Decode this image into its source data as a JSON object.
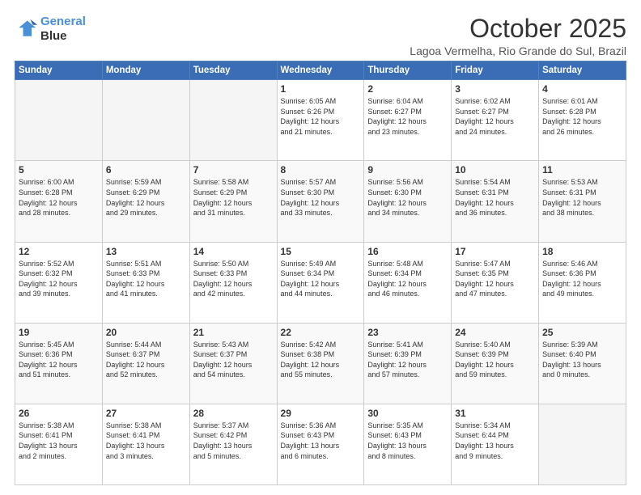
{
  "logo": {
    "line1": "General",
    "line2": "Blue"
  },
  "header": {
    "month": "October 2025",
    "location": "Lagoa Vermelha, Rio Grande do Sul, Brazil"
  },
  "weekdays": [
    "Sunday",
    "Monday",
    "Tuesday",
    "Wednesday",
    "Thursday",
    "Friday",
    "Saturday"
  ],
  "weeks": [
    [
      {
        "day": "",
        "info": ""
      },
      {
        "day": "",
        "info": ""
      },
      {
        "day": "",
        "info": ""
      },
      {
        "day": "1",
        "info": "Sunrise: 6:05 AM\nSunset: 6:26 PM\nDaylight: 12 hours\nand 21 minutes."
      },
      {
        "day": "2",
        "info": "Sunrise: 6:04 AM\nSunset: 6:27 PM\nDaylight: 12 hours\nand 23 minutes."
      },
      {
        "day": "3",
        "info": "Sunrise: 6:02 AM\nSunset: 6:27 PM\nDaylight: 12 hours\nand 24 minutes."
      },
      {
        "day": "4",
        "info": "Sunrise: 6:01 AM\nSunset: 6:28 PM\nDaylight: 12 hours\nand 26 minutes."
      }
    ],
    [
      {
        "day": "5",
        "info": "Sunrise: 6:00 AM\nSunset: 6:28 PM\nDaylight: 12 hours\nand 28 minutes."
      },
      {
        "day": "6",
        "info": "Sunrise: 5:59 AM\nSunset: 6:29 PM\nDaylight: 12 hours\nand 29 minutes."
      },
      {
        "day": "7",
        "info": "Sunrise: 5:58 AM\nSunset: 6:29 PM\nDaylight: 12 hours\nand 31 minutes."
      },
      {
        "day": "8",
        "info": "Sunrise: 5:57 AM\nSunset: 6:30 PM\nDaylight: 12 hours\nand 33 minutes."
      },
      {
        "day": "9",
        "info": "Sunrise: 5:56 AM\nSunset: 6:30 PM\nDaylight: 12 hours\nand 34 minutes."
      },
      {
        "day": "10",
        "info": "Sunrise: 5:54 AM\nSunset: 6:31 PM\nDaylight: 12 hours\nand 36 minutes."
      },
      {
        "day": "11",
        "info": "Sunrise: 5:53 AM\nSunset: 6:31 PM\nDaylight: 12 hours\nand 38 minutes."
      }
    ],
    [
      {
        "day": "12",
        "info": "Sunrise: 5:52 AM\nSunset: 6:32 PM\nDaylight: 12 hours\nand 39 minutes."
      },
      {
        "day": "13",
        "info": "Sunrise: 5:51 AM\nSunset: 6:33 PM\nDaylight: 12 hours\nand 41 minutes."
      },
      {
        "day": "14",
        "info": "Sunrise: 5:50 AM\nSunset: 6:33 PM\nDaylight: 12 hours\nand 42 minutes."
      },
      {
        "day": "15",
        "info": "Sunrise: 5:49 AM\nSunset: 6:34 PM\nDaylight: 12 hours\nand 44 minutes."
      },
      {
        "day": "16",
        "info": "Sunrise: 5:48 AM\nSunset: 6:34 PM\nDaylight: 12 hours\nand 46 minutes."
      },
      {
        "day": "17",
        "info": "Sunrise: 5:47 AM\nSunset: 6:35 PM\nDaylight: 12 hours\nand 47 minutes."
      },
      {
        "day": "18",
        "info": "Sunrise: 5:46 AM\nSunset: 6:36 PM\nDaylight: 12 hours\nand 49 minutes."
      }
    ],
    [
      {
        "day": "19",
        "info": "Sunrise: 5:45 AM\nSunset: 6:36 PM\nDaylight: 12 hours\nand 51 minutes."
      },
      {
        "day": "20",
        "info": "Sunrise: 5:44 AM\nSunset: 6:37 PM\nDaylight: 12 hours\nand 52 minutes."
      },
      {
        "day": "21",
        "info": "Sunrise: 5:43 AM\nSunset: 6:37 PM\nDaylight: 12 hours\nand 54 minutes."
      },
      {
        "day": "22",
        "info": "Sunrise: 5:42 AM\nSunset: 6:38 PM\nDaylight: 12 hours\nand 55 minutes."
      },
      {
        "day": "23",
        "info": "Sunrise: 5:41 AM\nSunset: 6:39 PM\nDaylight: 12 hours\nand 57 minutes."
      },
      {
        "day": "24",
        "info": "Sunrise: 5:40 AM\nSunset: 6:39 PM\nDaylight: 12 hours\nand 59 minutes."
      },
      {
        "day": "25",
        "info": "Sunrise: 5:39 AM\nSunset: 6:40 PM\nDaylight: 13 hours\nand 0 minutes."
      }
    ],
    [
      {
        "day": "26",
        "info": "Sunrise: 5:38 AM\nSunset: 6:41 PM\nDaylight: 13 hours\nand 2 minutes."
      },
      {
        "day": "27",
        "info": "Sunrise: 5:38 AM\nSunset: 6:41 PM\nDaylight: 13 hours\nand 3 minutes."
      },
      {
        "day": "28",
        "info": "Sunrise: 5:37 AM\nSunset: 6:42 PM\nDaylight: 13 hours\nand 5 minutes."
      },
      {
        "day": "29",
        "info": "Sunrise: 5:36 AM\nSunset: 6:43 PM\nDaylight: 13 hours\nand 6 minutes."
      },
      {
        "day": "30",
        "info": "Sunrise: 5:35 AM\nSunset: 6:43 PM\nDaylight: 13 hours\nand 8 minutes."
      },
      {
        "day": "31",
        "info": "Sunrise: 5:34 AM\nSunset: 6:44 PM\nDaylight: 13 hours\nand 9 minutes."
      },
      {
        "day": "",
        "info": ""
      }
    ]
  ],
  "row_shades": [
    false,
    true,
    false,
    true,
    false
  ]
}
